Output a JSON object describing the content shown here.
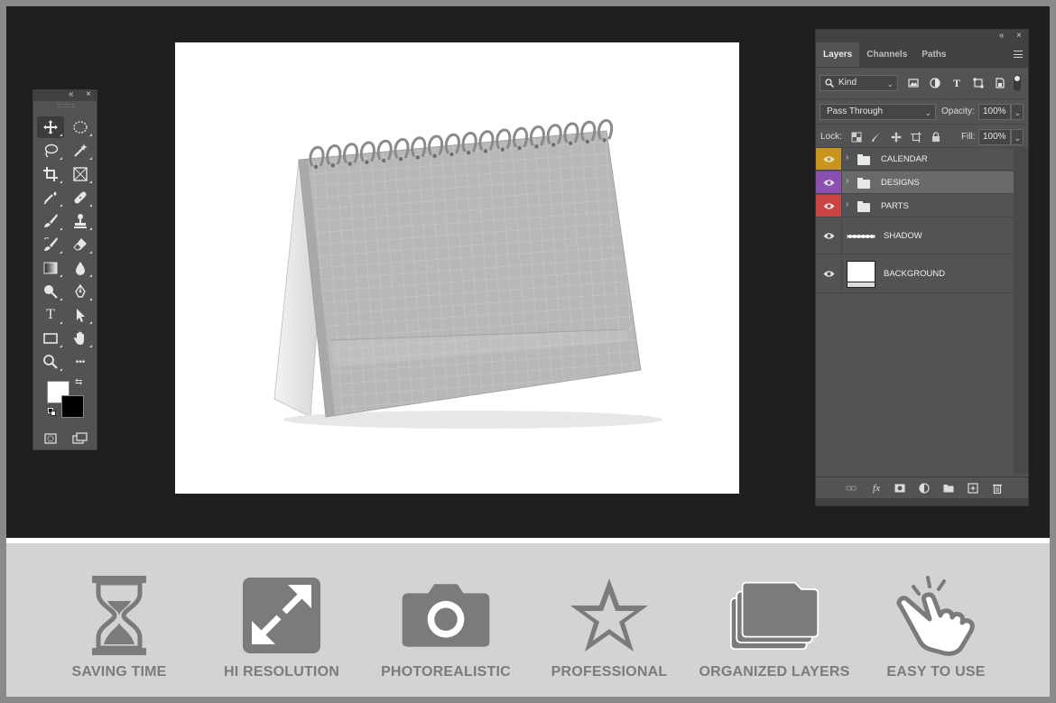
{
  "tools_panel": {
    "collapse_glyph": "«",
    "close_glyph": "×",
    "items": [
      {
        "icon": "move-icon"
      },
      {
        "icon": "elliptical-marquee-icon"
      },
      {
        "icon": "lasso-icon"
      },
      {
        "icon": "magic-wand-icon"
      },
      {
        "icon": "crop-icon"
      },
      {
        "icon": "frame-icon"
      },
      {
        "icon": "eyedropper-icon"
      },
      {
        "icon": "healing-brush-icon"
      },
      {
        "icon": "brush-icon"
      },
      {
        "icon": "clone-stamp-icon"
      },
      {
        "icon": "history-brush-icon"
      },
      {
        "icon": "eraser-icon"
      },
      {
        "icon": "gradient-icon"
      },
      {
        "icon": "blur-drop-icon"
      },
      {
        "icon": "dodge-icon"
      },
      {
        "icon": "pen-icon"
      },
      {
        "icon": "type-icon",
        "glyph": "T"
      },
      {
        "icon": "path-selection-icon"
      },
      {
        "icon": "rectangle-icon"
      },
      {
        "icon": "hand-icon"
      },
      {
        "icon": "zoom-icon"
      },
      {
        "icon": "more-tools-icon",
        "glyph": "•••"
      }
    ],
    "foreground_color": "#ffffff",
    "background_color": "#000000",
    "swap_glyph": "⇆"
  },
  "layers_panel": {
    "collapse_glyph": "«",
    "close_glyph": "×",
    "tabs": [
      {
        "label": "Layers",
        "active": true
      },
      {
        "label": "Channels",
        "active": false
      },
      {
        "label": "Paths",
        "active": false
      }
    ],
    "filter": {
      "value": "Kind"
    },
    "blend_mode": {
      "value": "Pass Through"
    },
    "opacity": {
      "label": "Opacity:",
      "value": "100%"
    },
    "lock": {
      "label": "Lock:"
    },
    "fill": {
      "label": "Fill:",
      "value": "100%"
    },
    "layers": [
      {
        "name": "CALENDAR",
        "type": "group",
        "color": "#c9961a",
        "selected": false
      },
      {
        "name": "DESIGNS",
        "type": "group",
        "color": "#8a4fb0",
        "selected": true
      },
      {
        "name": "PARTS",
        "type": "group",
        "color": "#c94343",
        "selected": false
      },
      {
        "name": "SHADOW",
        "type": "layer",
        "color": "",
        "selected": false
      },
      {
        "name": "BACKGROUND",
        "type": "layer",
        "color": "",
        "selected": false
      }
    ],
    "footer_glyph_fx": "fx"
  },
  "features": [
    {
      "label": "SAVING TIME",
      "icon": "hourglass-icon"
    },
    {
      "label": "HI RESOLUTION",
      "icon": "expand-arrows-icon"
    },
    {
      "label": "PHOTOREALISTIC",
      "icon": "camera-icon"
    },
    {
      "label": "PROFESSIONAL",
      "icon": "star-icon"
    },
    {
      "label": "ORGANIZED LAYERS",
      "icon": "stacked-folders-icon"
    },
    {
      "label": "EASY TO USE",
      "icon": "tap-hand-icon"
    }
  ],
  "colors": {
    "workspace": "#1f1f1f",
    "panel": "#535353",
    "feature_icon": "#7b7b7b",
    "feature_bar": "#d3d3d3"
  }
}
